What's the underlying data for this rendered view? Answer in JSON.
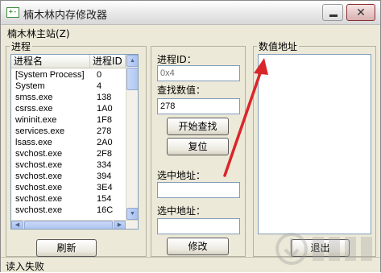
{
  "window": {
    "title": "楠木林内存修改器",
    "icon_text": "+-"
  },
  "menu": {
    "items": [
      {
        "label": "楠木林主站(Z)"
      }
    ]
  },
  "process_panel": {
    "group_label": "进程",
    "columns": [
      "进程名",
      "进程ID"
    ],
    "rows": [
      [
        "[System Process]",
        "0"
      ],
      [
        "System",
        "4"
      ],
      [
        "smss.exe",
        "138"
      ],
      [
        "csrss.exe",
        "1A0"
      ],
      [
        "wininit.exe",
        "1F8"
      ],
      [
        "services.exe",
        "278"
      ],
      [
        "lsass.exe",
        "2A0"
      ],
      [
        "svchost.exe",
        "2F8"
      ],
      [
        "svchost.exe",
        "334"
      ],
      [
        "svchost.exe",
        "394"
      ],
      [
        "svchost.exe",
        "3E4"
      ],
      [
        "svchost.exe",
        "154"
      ],
      [
        "svchost.exe",
        "16C"
      ]
    ],
    "refresh_label": "刷新"
  },
  "search_panel": {
    "pid_label": "进程ID：",
    "pid_value": "0x4",
    "value_label": "查找数值：",
    "value_input": "278",
    "search_button": "开始查找",
    "reset_button": "复位",
    "addr1_label": "选中地址：",
    "addr1_value": "",
    "addr2_label": "选中地址：",
    "addr2_value": "",
    "modify_button": "修改"
  },
  "value_panel": {
    "group_label": "数值地址",
    "exit_button": "退出"
  },
  "status": {
    "text": "读入失败"
  },
  "colors": {
    "annotation_arrow": "#d9262b",
    "window_bg": "#ece9d8"
  }
}
